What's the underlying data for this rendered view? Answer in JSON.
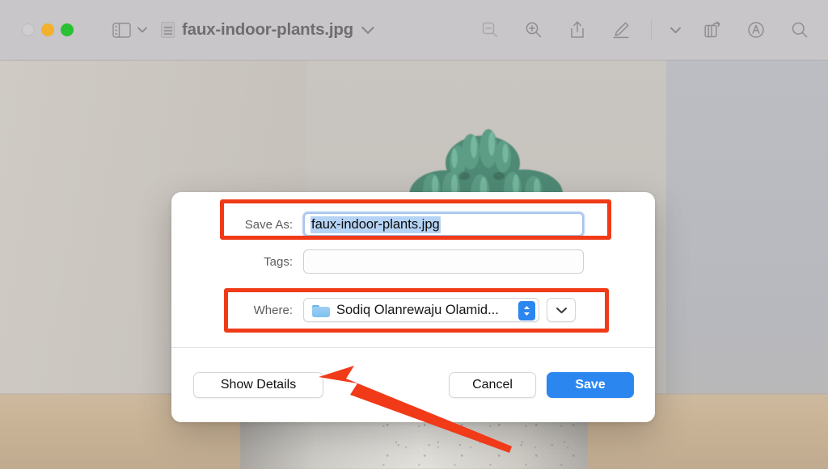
{
  "window": {
    "title": "faux-indoor-plants.jpg",
    "traffic_lights": [
      {
        "name": "close",
        "color": "#cfcdcf",
        "state": "disabled"
      },
      {
        "name": "minimize",
        "color": "#f2b02c",
        "state": "enabled"
      },
      {
        "name": "zoom",
        "color": "#2ac033",
        "state": "enabled"
      }
    ],
    "toolbar_icons_left": [
      "sidebar-icon",
      "chevron-down-icon"
    ],
    "title_icons": [
      "document-icon",
      "chevron-down-icon"
    ],
    "toolbar_icons_right": [
      "zoom-out-icon",
      "zoom-in-icon",
      "share-icon",
      "markup-pen-icon",
      "chevron-down-icon",
      "rotate-icon",
      "annotate-circle-icon",
      "search-icon"
    ]
  },
  "dialog": {
    "save_as": {
      "label": "Save As:",
      "value": "faux-indoor-plants.jpg",
      "placeholder": "",
      "selected": true,
      "highlighted": true
    },
    "tags": {
      "label": "Tags:",
      "value": "",
      "placeholder": ""
    },
    "where": {
      "label": "Where:",
      "value": "Sodiq Olanrewaju Olamid...",
      "folder_icon": "folder-icon",
      "stepper_icon": "up-down-stepper-icon",
      "expand_icon": "chevron-down-icon",
      "highlighted": true
    },
    "buttons": {
      "show_details": "Show Details",
      "cancel": "Cancel",
      "save": "Save"
    }
  },
  "annotations": {
    "highlight_color": "#f03a18",
    "arrow_color": "#f03a18",
    "arrow_target": "show-details-button",
    "boxes": [
      "save-as-field",
      "where-field"
    ]
  },
  "colors": {
    "accent_blue": "#2b86f0",
    "selection_blue": "#b5d3f4",
    "toolbar_gray": "#c8c6c8",
    "dialog_white": "#ffffff"
  },
  "photo": {
    "subject": "faux cactus in white speckled pot on wooden table"
  }
}
